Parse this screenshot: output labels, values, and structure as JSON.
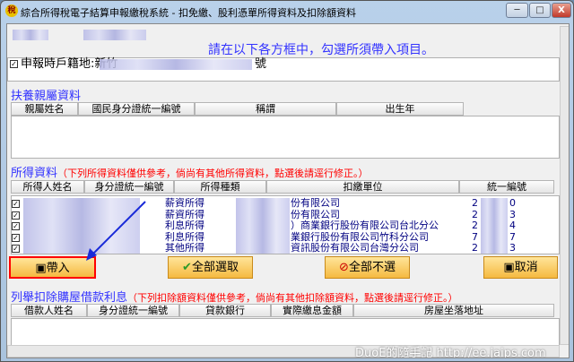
{
  "window": {
    "title": "綜合所得稅電子結算申報繳稅系統 - 扣免繳、股利憑單所得資料及扣除額資料",
    "icon": "稅",
    "minimize": "─",
    "maximize": "□",
    "close": "X"
  },
  "instruction": "請在以下各方框中，勾選所須帶入項目。",
  "address": {
    "checked": true,
    "label": "申報時戶籍地:新竹",
    "suffix": "號"
  },
  "dependents": {
    "title": "扶養親屬資料",
    "columns": [
      "親屬姓名",
      "國民身分證統一編號",
      "稱謂",
      "出生年"
    ]
  },
  "income": {
    "title": "所得資料",
    "note": "（下列所得資料僅供參考，倘尚有其他所得資料，點選後請逕行修正。）",
    "columns": [
      "所得人姓名",
      "身分證統一編號",
      "所得種類",
      "扣繳單位",
      "統一編號"
    ],
    "rows": [
      {
        "type": "薪資所得",
        "payer": "份有限公司",
        "id_start": "2",
        "id_end": "0"
      },
      {
        "type": "薪資所得",
        "payer": "份有限公司",
        "id_start": "2",
        "id_end": "3"
      },
      {
        "type": "利息所得",
        "payer": "）商業銀行股份有限公司台北分公",
        "id_start": "2",
        "id_end": "4"
      },
      {
        "type": "利息所得",
        "payer": "業銀行股份有限公司竹科分公司",
        "id_start": "7",
        "id_end": "7"
      },
      {
        "type": "其他所得",
        "payer": "資訊股份有限公司台灣分公司",
        "id_start": "2",
        "id_end": "3"
      }
    ]
  },
  "buttons": {
    "import": "帶入",
    "select_all": "全部選取",
    "deselect_all": "全部不選",
    "cancel": "取消"
  },
  "mortgage": {
    "title": "列舉扣除購屋借款利息",
    "note": "（下列扣除額資料僅供參考，倘尚有其他扣除額資料，點選後請逕行修正。）",
    "columns": [
      "借款人姓名",
      "身分證統一編號",
      "貸款銀行",
      "實際繳息金額",
      "房屋坐落地址"
    ]
  },
  "watermark": "DuoE的隨手記 http://ee.jaips.com",
  "colors": {
    "accent_blue": "#3333ff",
    "note_red": "#ff0000",
    "highlight": "#ff0000"
  }
}
